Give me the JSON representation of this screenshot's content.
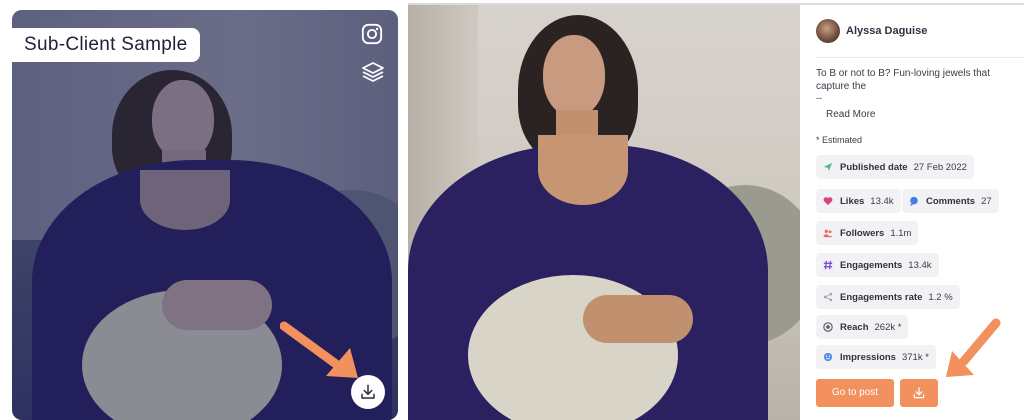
{
  "left_card": {
    "label": "Sub-Client Sample",
    "icons": [
      "instagram-icon",
      "layers-icon",
      "download-icon",
      "pointer-arrow-icon"
    ],
    "overlay_color": "#3f4468"
  },
  "right_card": {
    "author": {
      "name": "Alyssa Daguise"
    },
    "caption": "To B or not to B? Fun-loving jewels that capture the",
    "caption_dash": "--",
    "read_more": "Read More",
    "estimated_note": "* Estimated",
    "stats": {
      "published": {
        "label": "Published date",
        "value": "27 Feb 2022",
        "icon": "send-icon"
      },
      "likes": {
        "label": "Likes",
        "value": "13.4k",
        "icon": "heart-icon"
      },
      "comments": {
        "label": "Comments",
        "value": "27",
        "icon": "chat-bubble-icon"
      },
      "followers": {
        "label": "Followers",
        "value": "1.1m",
        "icon": "users-icon"
      },
      "engagements": {
        "label": "Engagements",
        "value": "13.4k",
        "icon": "hash-icon"
      },
      "engagements_rate": {
        "label": "Engagements rate",
        "value": "1.2 %",
        "icon": "share-icon"
      },
      "reach": {
        "label": "Reach",
        "value": "262k *",
        "icon": "target-icon"
      },
      "impressions": {
        "label": "Impressions",
        "value": "371k *",
        "icon": "smiley-icon"
      }
    },
    "go_to_post": "Go to post",
    "accent_color": "#f2905e"
  }
}
